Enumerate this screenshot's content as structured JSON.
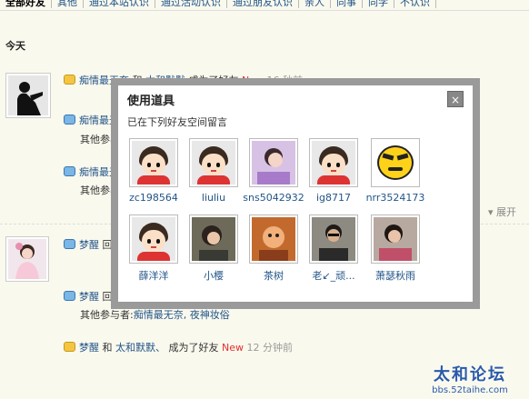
{
  "tabs": [
    "全部好友",
    "其他",
    "通过本站认识",
    "通过活动认识",
    "通过朋友认识",
    "亲人",
    "同事",
    "同学",
    "不认识"
  ],
  "section_title": "今天",
  "feed": [
    {
      "user": "痴情最无奈",
      "action": "和",
      "friend": "太和默默",
      "text": "成为了好友",
      "new": "New",
      "time": "16 秒前"
    },
    {
      "user": "痴情最无",
      "sub": "其他参与"
    },
    {
      "user": "痴情最无",
      "sub": "其他参与"
    },
    {
      "user": "梦醒",
      "action": "回"
    },
    {
      "user": "梦醒",
      "action": "回",
      "sub_label": "其他参与者:",
      "sub_users": "痴情最无奈, 夜神妆俗"
    },
    {
      "user": "梦醒",
      "action": "和",
      "friend": "太和默默、",
      "text": "成为了好友",
      "new": "New",
      "time": "12 分钟前"
    }
  ],
  "expand_label": "展开",
  "dialog": {
    "title": "使用道具",
    "close": "×",
    "description": "已在下列好友空间留言",
    "friends": [
      {
        "name": "zc198564",
        "avatar": "cartoon"
      },
      {
        "name": "liuliu",
        "avatar": "cartoon"
      },
      {
        "name": "sns5042932",
        "avatar": "photo-purple"
      },
      {
        "name": "ig8717",
        "avatar": "cartoon"
      },
      {
        "name": "nrr3524173",
        "avatar": "smiley"
      },
      {
        "name": "薛洋洋",
        "avatar": "cartoon"
      },
      {
        "name": "小樱",
        "avatar": "photo-dark"
      },
      {
        "name": "茶树",
        "avatar": "photo-orange"
      },
      {
        "name": "老↙_顽...",
        "avatar": "photo-man"
      },
      {
        "name": "萧瑟秋雨",
        "avatar": "photo-woman"
      }
    ]
  },
  "watermark": {
    "title": "太和论坛",
    "url": "bbs.52taihe.com"
  },
  "colors": {
    "link": "#225588",
    "new": "#e03030",
    "bg": "#faf9ee"
  }
}
